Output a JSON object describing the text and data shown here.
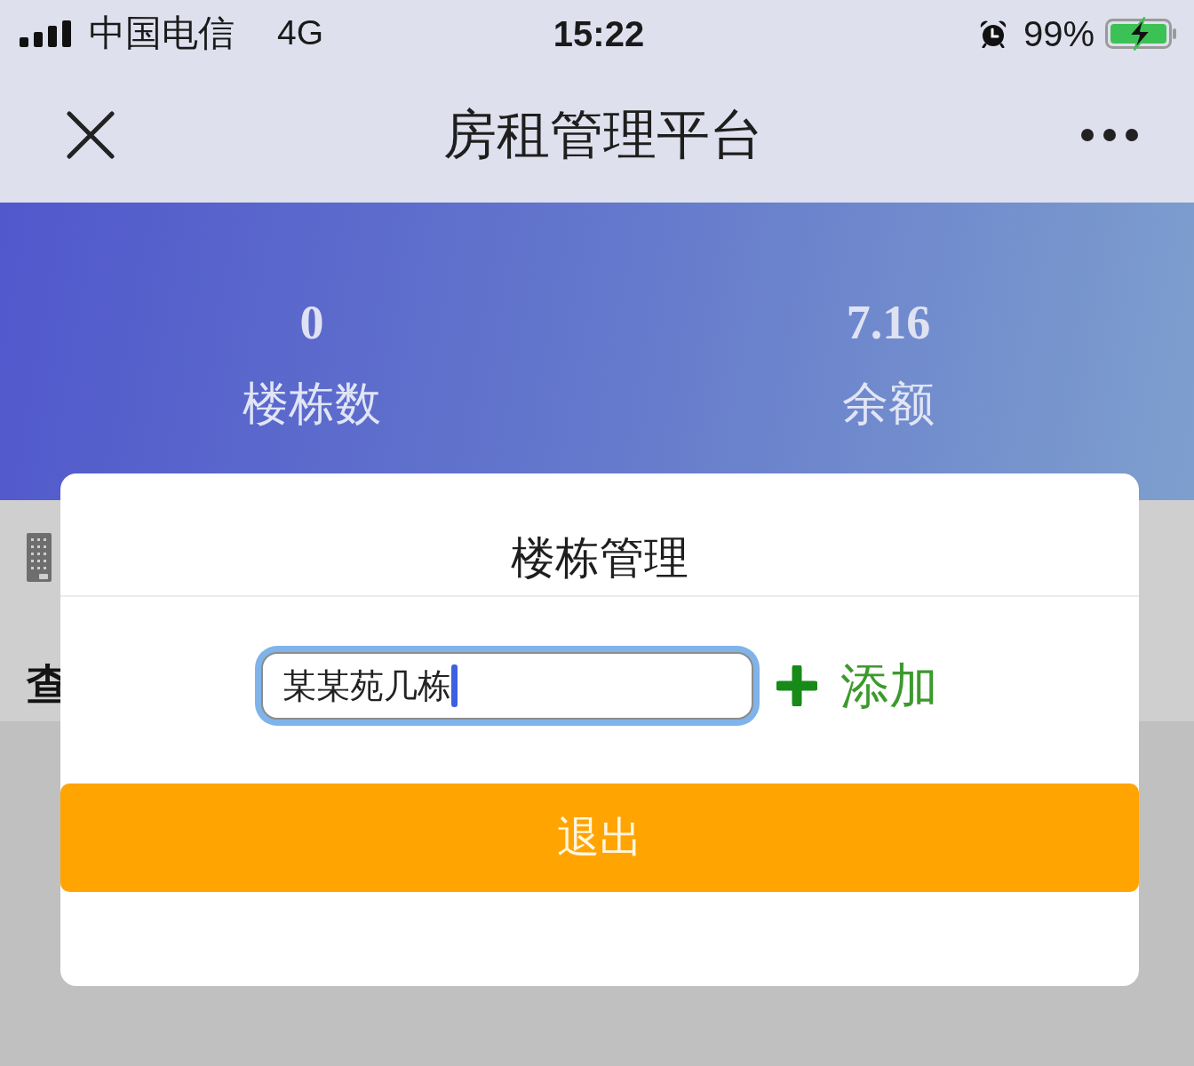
{
  "status_bar": {
    "carrier": "中国电信",
    "network": "4G",
    "time": "15:22",
    "alarm": true,
    "battery": "99%",
    "charging": true
  },
  "nav_bar": {
    "title": "房租管理平台"
  },
  "stats": [
    {
      "value": "0",
      "label": "楼栋数"
    },
    {
      "value": "7.16",
      "label": "余额"
    }
  ],
  "page": {
    "section_label": "查"
  },
  "dialog": {
    "title": "楼栋管理",
    "input": {
      "value": "某某苑几栋",
      "focused": true
    },
    "add_button": "添加",
    "exit_button": "退出"
  }
}
